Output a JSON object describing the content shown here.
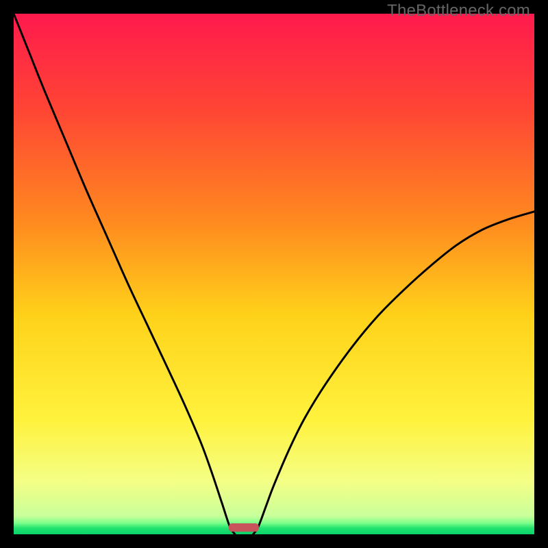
{
  "watermark": "TheBottleneck.com",
  "chart_data": {
    "type": "line",
    "title": "",
    "xlabel": "",
    "ylabel": "",
    "xlim": [
      0,
      100
    ],
    "ylim": [
      0,
      100
    ],
    "background": {
      "description": "vertical rainbow gradient, red top to green bottom, with a thin bright green band at the very bottom",
      "stops": [
        {
          "offset": 0.0,
          "color": "#ff1a4d"
        },
        {
          "offset": 0.18,
          "color": "#ff4435"
        },
        {
          "offset": 0.4,
          "color": "#ff8a1f"
        },
        {
          "offset": 0.58,
          "color": "#ffd21a"
        },
        {
          "offset": 0.78,
          "color": "#fff23d"
        },
        {
          "offset": 0.9,
          "color": "#f4ff86"
        },
        {
          "offset": 0.965,
          "color": "#c8ff9a"
        },
        {
          "offset": 0.978,
          "color": "#7fff8a"
        },
        {
          "offset": 0.988,
          "color": "#21e36e"
        },
        {
          "offset": 1.0,
          "color": "#0ad46a"
        }
      ]
    },
    "series": [
      {
        "name": "left-arc",
        "description": "curve descending from top-left corner down to the minimum near x≈42 at y≈0",
        "values": [
          {
            "x": 0.0,
            "y": 100.0
          },
          {
            "x": 3.0,
            "y": 92.5
          },
          {
            "x": 6.0,
            "y": 85.0
          },
          {
            "x": 10.0,
            "y": 75.5
          },
          {
            "x": 14.0,
            "y": 66.0
          },
          {
            "x": 18.0,
            "y": 57.0
          },
          {
            "x": 22.0,
            "y": 48.0
          },
          {
            "x": 26.0,
            "y": 39.5
          },
          {
            "x": 30.0,
            "y": 31.0
          },
          {
            "x": 33.0,
            "y": 24.5
          },
          {
            "x": 36.0,
            "y": 17.5
          },
          {
            "x": 38.0,
            "y": 12.0
          },
          {
            "x": 40.0,
            "y": 6.0
          },
          {
            "x": 41.5,
            "y": 1.5
          },
          {
            "x": 42.5,
            "y": 0.0
          }
        ]
      },
      {
        "name": "right-arc",
        "description": "curve rising from the minimum near x≈46 up toward the right edge at y≈62",
        "values": [
          {
            "x": 46.0,
            "y": 0.0
          },
          {
            "x": 47.0,
            "y": 1.5
          },
          {
            "x": 48.5,
            "y": 5.5
          },
          {
            "x": 50.0,
            "y": 9.5
          },
          {
            "x": 53.0,
            "y": 16.5
          },
          {
            "x": 56.0,
            "y": 22.5
          },
          {
            "x": 60.0,
            "y": 29.0
          },
          {
            "x": 65.0,
            "y": 36.0
          },
          {
            "x": 70.0,
            "y": 42.0
          },
          {
            "x": 75.0,
            "y": 47.0
          },
          {
            "x": 80.0,
            "y": 51.5
          },
          {
            "x": 85.0,
            "y": 55.5
          },
          {
            "x": 90.0,
            "y": 58.5
          },
          {
            "x": 95.0,
            "y": 60.5
          },
          {
            "x": 100.0,
            "y": 62.0
          }
        ]
      }
    ],
    "marker": {
      "description": "small rounded red bar at the bottom between the two curves",
      "x_center": 44.2,
      "width": 5.8,
      "y": 0.5,
      "height": 1.6,
      "color": "#c9535b"
    }
  }
}
